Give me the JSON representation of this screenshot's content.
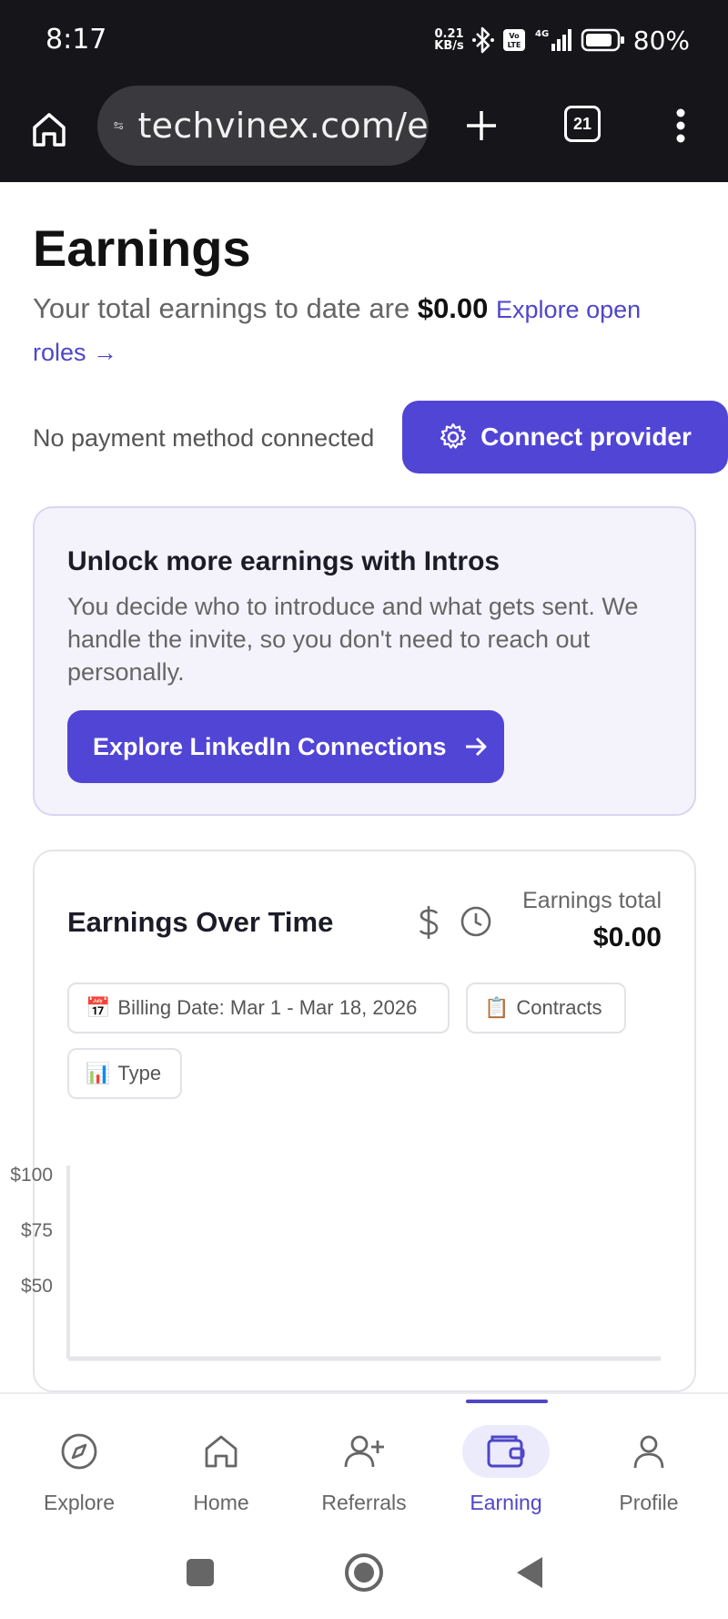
{
  "status_bar": {
    "time": "8:17",
    "net_speed_value": "0.21",
    "net_speed_unit": "KB/s",
    "battery_pct": "80%"
  },
  "browser": {
    "url": "techvinex.com/e",
    "tab_count": "21"
  },
  "page": {
    "title": "Earnings",
    "summary_prefix": "Your total earnings to date are ",
    "summary_amount": "$0.00",
    "summary_link": "Explore open roles →",
    "payment_status": "No payment method connected",
    "connect_button": "Connect provider"
  },
  "intro_card": {
    "title": "Unlock more earnings with Intros",
    "description": "You decide who to introduce and what gets sent. We handle the invite, so you don't need to reach out personally.",
    "button": "Explore LinkedIn Connections"
  },
  "chart_card": {
    "title": "Earnings Over Time",
    "total_label": "Earnings total",
    "total_value": "$0.00",
    "filters": [
      {
        "emoji": "📅",
        "label": "Billing Date: Mar 1 - Mar 18, 2026"
      },
      {
        "emoji": "📋",
        "label": "Contracts"
      },
      {
        "emoji": "📊",
        "label": "Type"
      }
    ]
  },
  "chart_data": {
    "type": "bar",
    "title": "Earnings Over Time",
    "yticks": [
      "$100",
      "$75",
      "$50"
    ],
    "ylim": [
      0,
      100
    ],
    "series": [],
    "grid": false
  },
  "bottom_nav": {
    "items": [
      {
        "label": "Explore",
        "icon": "compass-icon"
      },
      {
        "label": "Home",
        "icon": "home-icon"
      },
      {
        "label": "Referrals",
        "icon": "add-user-icon"
      },
      {
        "label": "Earning",
        "icon": "wallet-icon",
        "active": true
      },
      {
        "label": "Profile",
        "icon": "person-icon"
      }
    ]
  },
  "colors": {
    "accent": "#5145d6",
    "link": "#4f46c8",
    "dark_bar": "#16161a"
  }
}
